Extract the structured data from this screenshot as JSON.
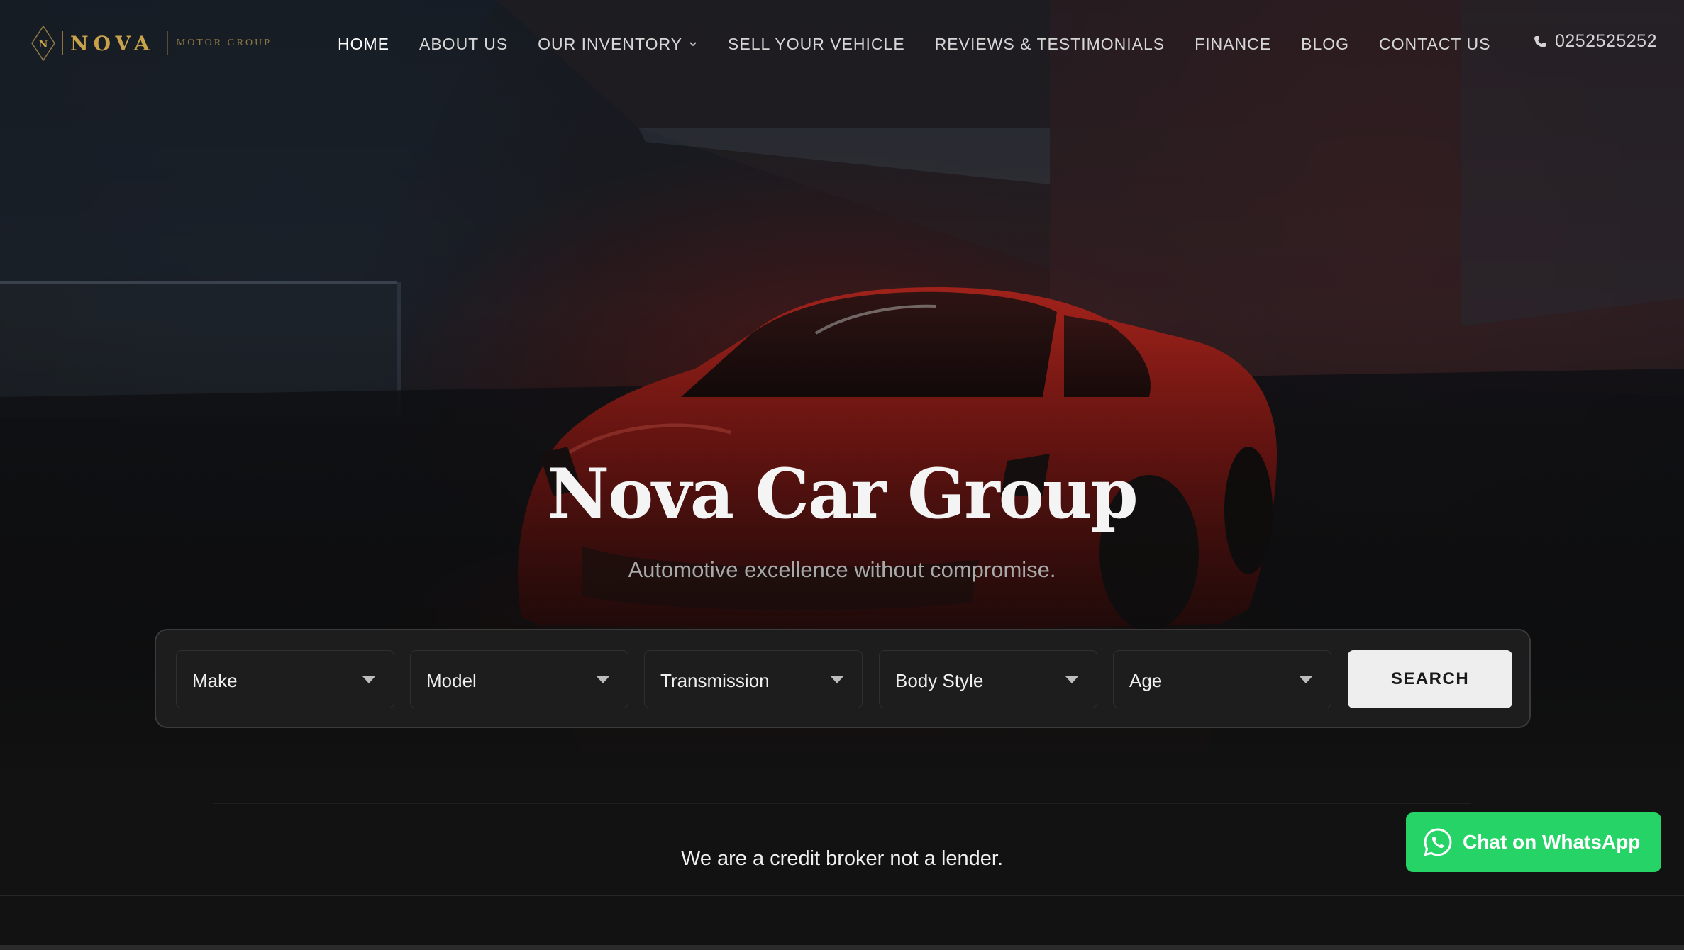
{
  "header": {
    "logo": {
      "monogram": "N",
      "brand": "NOVA",
      "tagline": "MOTOR GROUP"
    },
    "nav": [
      {
        "label": "HOME",
        "active": true
      },
      {
        "label": "ABOUT US"
      },
      {
        "label": "OUR INVENTORY",
        "has_dropdown": true
      },
      {
        "label": "SELL YOUR VEHICLE"
      },
      {
        "label": "REVIEWS & TESTIMONIALS"
      },
      {
        "label": "FINANCE"
      },
      {
        "label": "BLOG"
      },
      {
        "label": "CONTACT US"
      }
    ],
    "phone": {
      "icon": "phone-icon",
      "number": "0252525252"
    }
  },
  "hero": {
    "title": "Nova Car Group",
    "subtitle": "Automotive excellence without compromise."
  },
  "search": {
    "filters": [
      {
        "label": "Make"
      },
      {
        "label": "Model"
      },
      {
        "label": "Transmission"
      },
      {
        "label": "Body Style"
      },
      {
        "label": "Age"
      }
    ],
    "button_label": "SEARCH"
  },
  "notice": {
    "text": "We are a credit broker not a lender."
  },
  "whatsapp": {
    "label": "Chat on WhatsApp",
    "icon": "whatsapp-icon",
    "color": "#25d366"
  },
  "colors": {
    "accent_gold": "#c8a24a",
    "background": "#121212",
    "car_red": "#9b1c16"
  }
}
